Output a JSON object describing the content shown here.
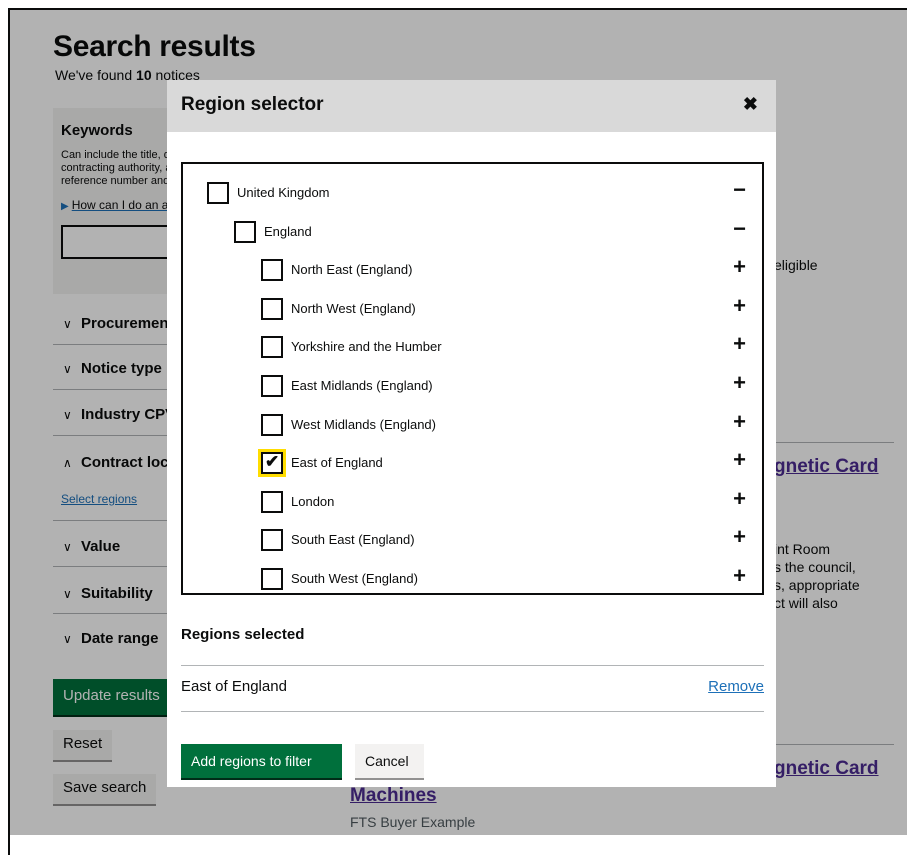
{
  "page": {
    "title": "Search results",
    "found_prefix": "We've found ",
    "found_count": "10",
    "found_suffix": " notices"
  },
  "filters": {
    "keywords_title": "Keywords",
    "keywords_desc": "Can include the title, description, contracting authority, awarded supplier, reference number and document number",
    "keywords_link": "How can I do an advanced search?",
    "sections": [
      "Procurement stage",
      "Notice type",
      "Industry CPV codes",
      "Contract location",
      "Value",
      "Suitability",
      "Date range"
    ],
    "select_regions_link": "Select regions",
    "update_button": "Update results",
    "reset_button": "Reset",
    "save_button": "Save search"
  },
  "results": {
    "eligible_text": "eligible",
    "link_1": "gnetic Card",
    "snippet_lines": [
      "int Room",
      "s the council,",
      "s, appropriate",
      "ct will also"
    ],
    "link_2": "gnetic Card",
    "link_2_line2": "Machines",
    "buyer": "FTS Buyer Example"
  },
  "modal": {
    "title": "Region selector",
    "close_icon": "✖",
    "tree": [
      {
        "label": "United Kingdom",
        "checked": false,
        "toggle": "−",
        "level": 0
      },
      {
        "label": "England",
        "checked": false,
        "toggle": "−",
        "level": 1
      },
      {
        "label": "North East (England)",
        "checked": false,
        "toggle": "+",
        "level": 2
      },
      {
        "label": "North West (England)",
        "checked": false,
        "toggle": "+",
        "level": 2
      },
      {
        "label": "Yorkshire and the Humber",
        "checked": false,
        "toggle": "+",
        "level": 2
      },
      {
        "label": "East Midlands (England)",
        "checked": false,
        "toggle": "+",
        "level": 2
      },
      {
        "label": "West Midlands (England)",
        "checked": false,
        "toggle": "+",
        "level": 2
      },
      {
        "label": "East of England",
        "checked": true,
        "toggle": "+",
        "level": 2
      },
      {
        "label": "London",
        "checked": false,
        "toggle": "+",
        "level": 2
      },
      {
        "label": "South East (England)",
        "checked": false,
        "toggle": "+",
        "level": 2
      },
      {
        "label": "South West (England)",
        "checked": false,
        "toggle": "+",
        "level": 2
      }
    ],
    "selected_title": "Regions selected",
    "selected_items": [
      {
        "label": "East of England",
        "remove_label": "Remove"
      }
    ],
    "add_button": "Add regions to filter",
    "cancel_button": "Cancel"
  },
  "colors": {
    "button_green": "#00703c",
    "link_blue": "#1d70b8",
    "focus_yellow": "#ffdd00",
    "modal_header": "#d9d9d9"
  }
}
